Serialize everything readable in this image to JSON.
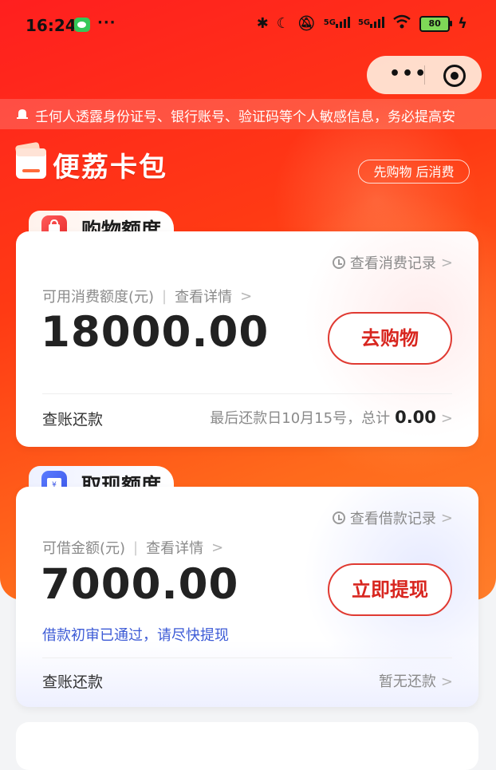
{
  "status_bar": {
    "time": "16:24",
    "dots": "···",
    "signal1": "5G",
    "signal2": "5G",
    "battery": "80"
  },
  "capsule": {
    "more": "•••"
  },
  "notice": {
    "text": "壬何人透露身份证号、银行账号、验证码等个人敏感信息，务必提高安"
  },
  "brand": {
    "name": "便荔卡包",
    "tagline": "先购物 后消费"
  },
  "shopping": {
    "title": "购物额度",
    "record_link": "查看消费记录",
    "label": "可用消费额度(元)",
    "detail_link": "查看详情",
    "amount": "18000.00",
    "button": "去购物",
    "repay_label": "查账还款",
    "repay_info": "最后还款日10月15号，总计",
    "repay_total": "0.00"
  },
  "cash": {
    "title": "取现额度",
    "record_link": "查看借款记录",
    "label": "可借金额(元)",
    "detail_link": "查看详情",
    "amount": "7000.00",
    "button": "立即提现",
    "approved_text": "借款初审已通过，请尽快提现",
    "repay_label": "查账还款",
    "repay_info": "暂无还款"
  },
  "colors": {
    "accent": "#ff2a1a",
    "button_text": "#d8261f",
    "approved": "#3d5bd6"
  }
}
